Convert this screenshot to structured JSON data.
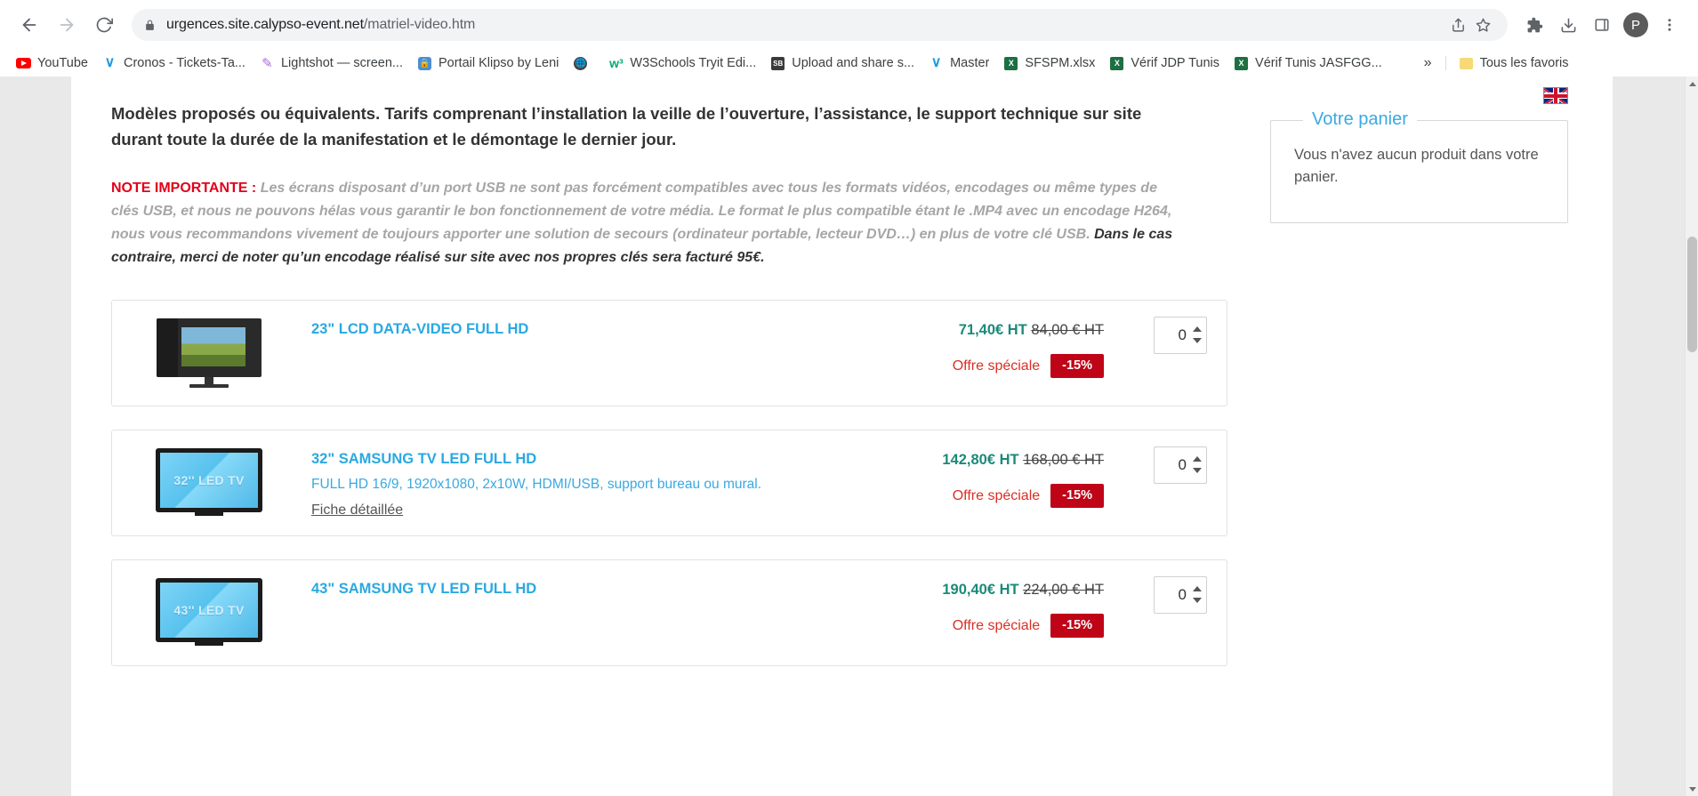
{
  "browser": {
    "url_host": "urgences.site.calypso-event.net",
    "url_path": "/matriel-video.htm",
    "back_icon": "back-arrow-icon",
    "forward_icon": "forward-arrow-icon",
    "reload_icon": "reload-icon",
    "lock_icon": "lock-icon",
    "share_icon": "share-icon",
    "star_icon": "star-icon",
    "extensions_icon": "puzzle-icon",
    "downloads_icon": "download-icon",
    "sidepanel_icon": "side-panel-icon",
    "profile_initial": "P",
    "menu_icon": "three-dot-menu-icon"
  },
  "bookmarks": {
    "items": [
      {
        "label": "YouTube",
        "icon": "youtube-icon"
      },
      {
        "label": "Cronos - Tickets-Ta...",
        "icon": "cronos-icon"
      },
      {
        "label": "Lightshot — screen...",
        "icon": "lightshot-feather-icon"
      },
      {
        "label": "Portail Klipso by Leni",
        "icon": "klipso-lock-icon"
      },
      {
        "label": "",
        "icon": "globe-icon"
      },
      {
        "label": "W3Schools Tryit Edi...",
        "icon": "w3schools-icon"
      },
      {
        "label": "Upload and share s...",
        "icon": "screenshot-sb-icon"
      },
      {
        "label": "Master",
        "icon": "cronos-icon"
      },
      {
        "label": "SFSPM.xlsx",
        "icon": "excel-icon"
      },
      {
        "label": "Vérif JDP Tunis",
        "icon": "excel-icon"
      },
      {
        "label": "Vérif Tunis JASFGG...",
        "icon": "excel-icon"
      }
    ],
    "overflow_label": "»",
    "all_bookmarks_label": "Tous les favoris",
    "all_bookmarks_icon": "folder-icon"
  },
  "page": {
    "language_flag": "uk-flag-icon",
    "intro_heading": "Modèles proposés ou équivalents. Tarifs comprenant l’installation la veille de l’ouverture, l’assistance, le support technique sur site durant toute la durée de la manifestation et le démontage le dernier jour.",
    "note": {
      "lead": "NOTE IMPORTANTE :",
      "body_1": " Les écrans disposant d’un port USB ne sont pas forcément compatibles avec tous les formats vidéos, encodages ou même types de clés USB, et nous ne pouvons hélas vous garantir le bon fonctionnement de votre média. Le format le plus compatible étant le .MP4 avec un encodage H264, nous vous recommandons vivement de toujours apporter une solution de secours (ordinateur portable, lecteur DVD…) en plus de votre clé USB. ",
      "body_2": "Dans le cas contraire, merci de noter qu’un encodage réalisé sur site avec nos propres clés sera facturé 95€."
    },
    "products": [
      {
        "thumb_type": "monitor",
        "thumb_label": "",
        "title": "23\" LCD DATA-VIDEO FULL HD",
        "description": "",
        "detail_link": "",
        "price_new": "71,40€ HT",
        "price_old": "84,00 € HT",
        "offer_label": "Offre spéciale",
        "discount_badge": "-15%",
        "quantity": "0"
      },
      {
        "thumb_type": "tv",
        "thumb_label": "32'' LED TV",
        "title": "32\" SAMSUNG TV LED FULL HD",
        "description": "FULL HD 16/9, 1920x1080, 2x10W, HDMI/USB, support bureau ou mural.",
        "detail_link": "Fiche détaillée",
        "price_new": "142,80€ HT",
        "price_old": "168,00 € HT",
        "offer_label": "Offre spéciale",
        "discount_badge": "-15%",
        "quantity": "0"
      },
      {
        "thumb_type": "tv",
        "thumb_label": "43'' LED TV",
        "title": "43\" SAMSUNG TV LED FULL HD",
        "description": "",
        "detail_link": "",
        "price_new": "190,40€ HT",
        "price_old": "224,00 € HT",
        "offer_label": "Offre spéciale",
        "discount_badge": "-15%",
        "quantity": "0"
      }
    ],
    "cart": {
      "legend": "Votre panier",
      "empty_message": "Vous n'avez aucun produit dans votre panier."
    }
  },
  "colors": {
    "link_blue": "#29a9e1",
    "price_green": "#1a8a7a",
    "offer_red": "#d93025",
    "badge_red": "#c00418",
    "note_red": "#e2001a"
  }
}
